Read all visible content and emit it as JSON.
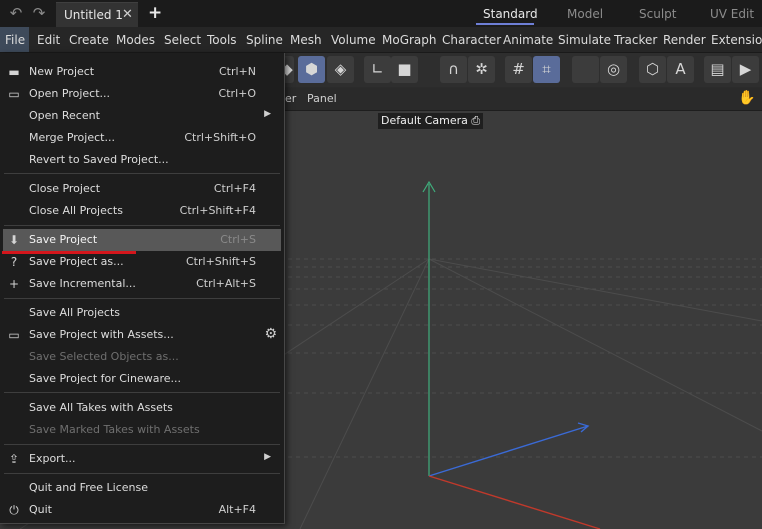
{
  "tabbar": {
    "doc_title": "Untitled 1",
    "close_glyph": "✕",
    "new_tab_glyph": "+",
    "layouts": [
      "Standard",
      "Model",
      "Sculpt",
      "UV Edit"
    ],
    "active_layout": "Standard"
  },
  "menubar": [
    "File",
    "Edit",
    "Create",
    "Modes",
    "Select",
    "Tools",
    "Spline",
    "Mesh",
    "Volume",
    "MoGraph",
    "Character",
    "Animate",
    "Simulate",
    "Tracker",
    "Render",
    "Extensions"
  ],
  "viewport": {
    "menus": [
      "er",
      "Panel"
    ],
    "camera_label": "Default Camera"
  },
  "file_menu": {
    "items": [
      {
        "label": "New Project",
        "shortcut": "Ctrl+N",
        "icon": "new-file-icon"
      },
      {
        "label": "Open Project...",
        "shortcut": "Ctrl+O",
        "icon": "folder-icon"
      },
      {
        "label": "Open Recent",
        "shortcut": "",
        "submenu": true
      },
      {
        "label": "Merge Project...",
        "shortcut": "Ctrl+Shift+O"
      },
      {
        "label": "Revert to Saved Project...",
        "shortcut": ""
      },
      {
        "label": "Close Project",
        "shortcut": "Ctrl+F4"
      },
      {
        "label": "Close All Projects",
        "shortcut": "Ctrl+Shift+F4"
      },
      {
        "label": "Save Project",
        "shortcut": "Ctrl+S",
        "icon": "save-icon",
        "highlighted": true
      },
      {
        "label": "Save Project as...",
        "shortcut": "Ctrl+Shift+S",
        "icon": "save-as-icon"
      },
      {
        "label": "Save Incremental...",
        "shortcut": "Ctrl+Alt+S",
        "icon": "save-incremental-icon"
      },
      {
        "label": "Save All Projects",
        "shortcut": ""
      },
      {
        "label": "Save Project with Assets...",
        "shortcut": "",
        "icon": "folder-icon",
        "gear": true
      },
      {
        "label": "Save Selected Objects as...",
        "shortcut": "",
        "disabled": true
      },
      {
        "label": "Save Project for Cineware...",
        "shortcut": ""
      },
      {
        "label": "Save All Takes with Assets",
        "shortcut": ""
      },
      {
        "label": "Save Marked Takes with Assets",
        "shortcut": "",
        "disabled": true
      },
      {
        "label": "Export...",
        "shortcut": "",
        "icon": "export-icon",
        "submenu": true
      },
      {
        "label": "Quit and Free License",
        "shortcut": ""
      },
      {
        "label": "Quit",
        "shortcut": "Alt+F4",
        "icon": "power-icon"
      }
    ]
  },
  "colors": {
    "highlight": "#585858",
    "accent_underline": "#d4161c",
    "axis_y": "#3fae7c",
    "axis_x": "#c0392b",
    "axis_z": "#3a6ad6"
  }
}
